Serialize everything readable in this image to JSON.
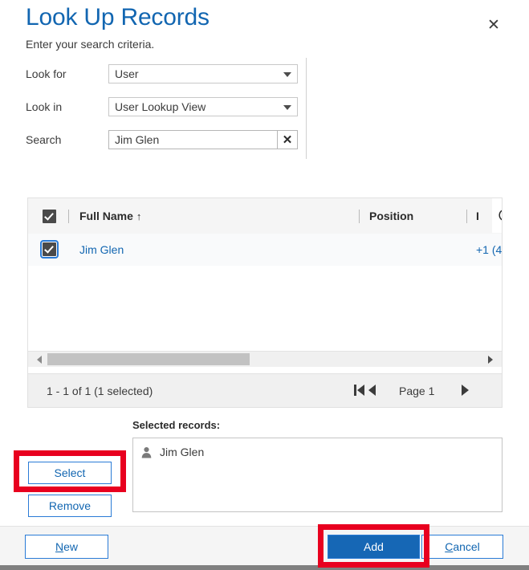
{
  "header": {
    "title": "Look Up Records",
    "subtitle": "Enter your search criteria.",
    "close_label": "✕",
    "close_icon": "close-icon",
    "title_color": "#1266b1"
  },
  "criteria": {
    "rows": [
      {
        "label": "Look for",
        "value": "User",
        "control": "dropdown"
      },
      {
        "label": "Look in",
        "value": "User Lookup View",
        "control": "dropdown"
      },
      {
        "label": "Search",
        "value": "Jim Glen",
        "control": "text",
        "clear_label": "✕"
      }
    ]
  },
  "grid": {
    "columns": [
      {
        "label": "Full Name",
        "sort": "↑"
      },
      {
        "label": "Position",
        "sort": ""
      },
      {
        "label": "I",
        "sort": ""
      }
    ],
    "refresh_icon": "refresh-icon",
    "rows": [
      {
        "name": "Jim Glen",
        "position": "",
        "phone": "+1 (4"
      }
    ]
  },
  "pager": {
    "count_text": "1 - 1 of 1 (1 selected)",
    "page_label": "Page 1",
    "first_icon": "first-page-icon",
    "prev_icon": "previous-page-icon",
    "next_icon": "next-page-icon"
  },
  "selected_records": {
    "label": "Selected records:",
    "items": [
      {
        "name": "Jim Glen",
        "icon": "person-icon"
      }
    ]
  },
  "side_actions": {
    "select_label": "Select",
    "remove_label": "Remove"
  },
  "footer": {
    "new_accel": "N",
    "new_rest": "ew",
    "add_label": "Add",
    "cancel_accel": "C",
    "cancel_rest": "ancel"
  },
  "annotations": {
    "color": "#e8001f"
  }
}
